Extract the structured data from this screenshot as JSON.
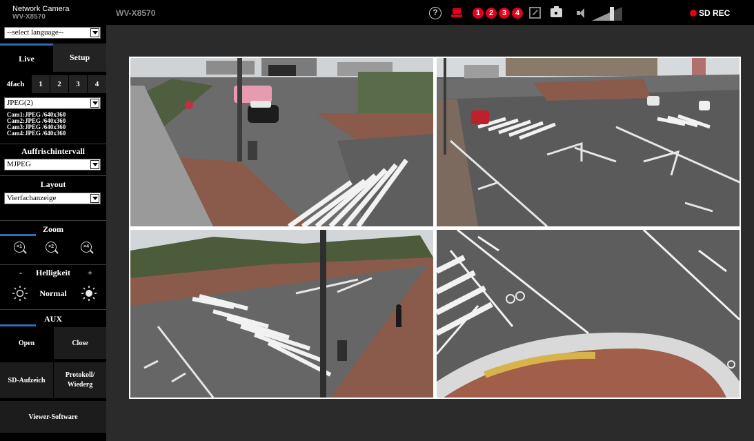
{
  "topbar": {
    "brand_title": "Network Camera",
    "brand_model": "WV-X8570",
    "camera_title": "WV-X8570",
    "help_icon": "?",
    "camera_numbers": [
      "1",
      "2",
      "3",
      "4"
    ],
    "sd_rec_label": "SD REC",
    "accent_red": "#e3001b"
  },
  "sidebar": {
    "language_select": "--select language--",
    "tabs": {
      "live": "Live",
      "setup": "Setup"
    },
    "layout_tabs": [
      "4fach",
      "1",
      "2",
      "3",
      "4"
    ],
    "stream_select": "JPEG(2)",
    "stream_info": [
      "Cam1:JPEG /640x360",
      "Cam2:JPEG /640x360",
      "Cam3:JPEG /640x360",
      "Cam4:JPEG /640x360"
    ],
    "refresh_title": "Auffrischintervall",
    "refresh_select": "MJPEG",
    "layout_title": "Layout",
    "layout_select": "Vierfachanzeige",
    "zoom_title": "Zoom",
    "zoom_buttons": [
      "×1",
      "×2",
      "×4"
    ],
    "brightness_title": "Helligkeit",
    "brightness_minus": "-",
    "brightness_plus": "+",
    "brightness_normal": "Normal",
    "aux_title": "AUX",
    "aux_open": "Open",
    "aux_close": "Close",
    "sd_record": "SD-Aufzeich",
    "log_line1": "Protokoll/",
    "log_line2": "Wiederg",
    "viewer_software": "Viewer-Software",
    "accent_blue": "#2e6eb6"
  }
}
